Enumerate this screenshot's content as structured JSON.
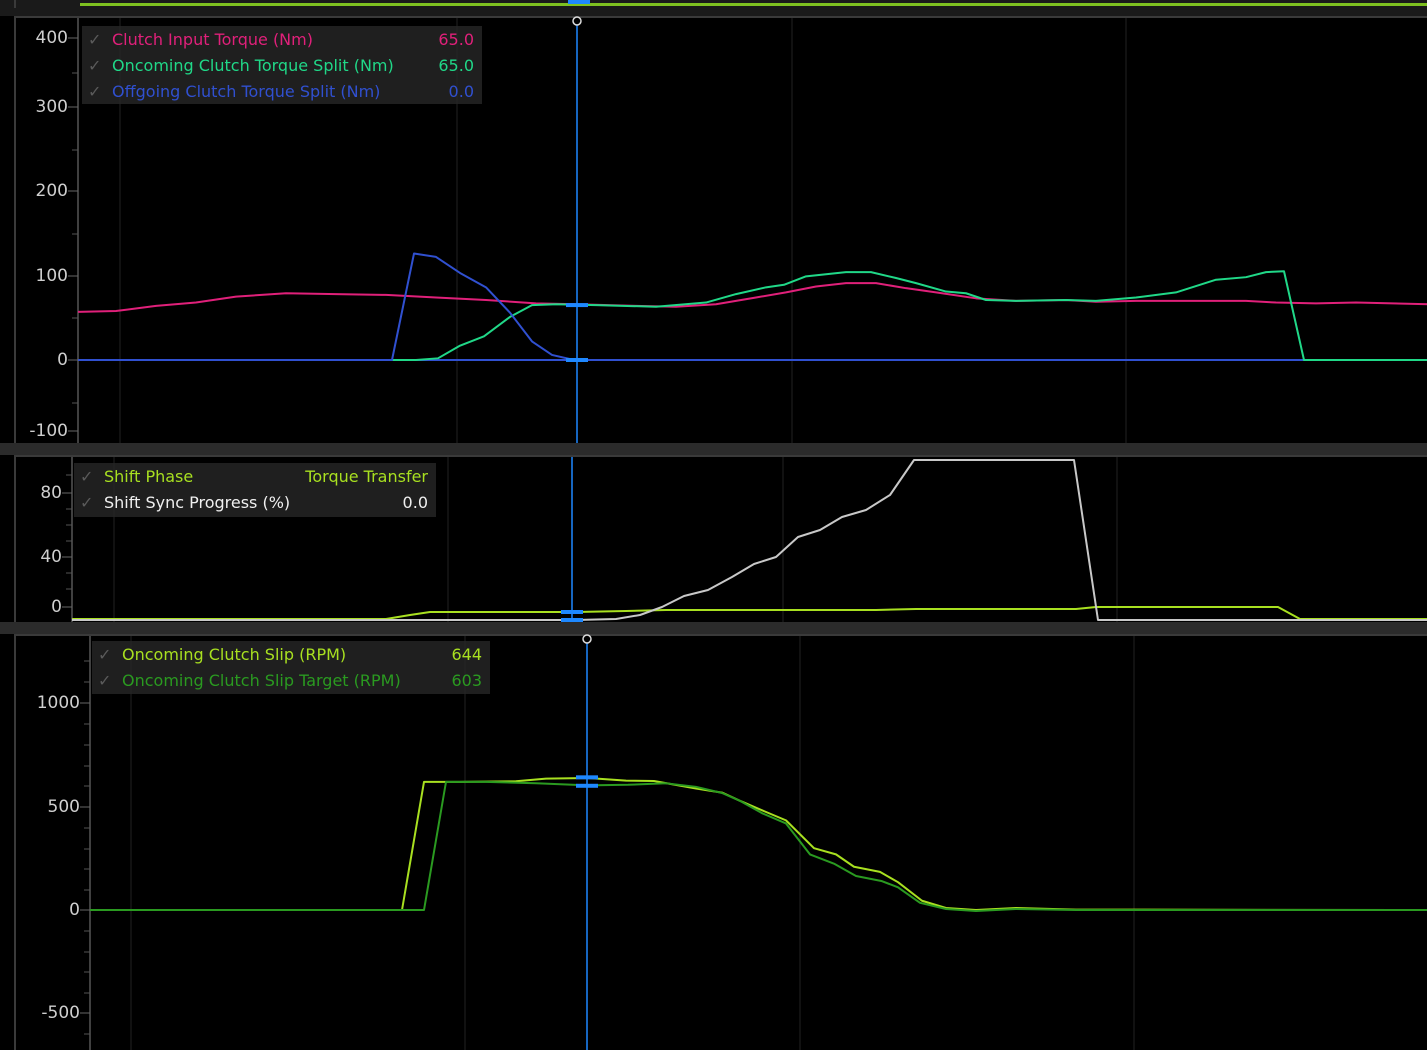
{
  "colors": {
    "magenta": "#e0207a",
    "green": "#20d888",
    "blue": "#3050d0",
    "cursor": "#1e88ff",
    "lime": "#a8e020",
    "darkgreen": "#2a9a20",
    "white": "#f0f0f0",
    "gray": "#c8c8c8"
  },
  "panels": [
    {
      "id": "torque",
      "y_ticks": [
        "400",
        "300",
        "200",
        "100",
        "0",
        "-100"
      ],
      "legend": [
        {
          "name": "Clutch Input Torque (Nm)",
          "value": "65.0",
          "color": "#e0207a"
        },
        {
          "name": "Oncoming Clutch Torque Split (Nm)",
          "value": "65.0",
          "color": "#20d888"
        },
        {
          "name": "Offgoing Clutch Torque Split (Nm)",
          "value": "0.0",
          "color": "#3050d0"
        }
      ]
    },
    {
      "id": "phase",
      "y_ticks": [
        "80",
        "40",
        "0"
      ],
      "legend": [
        {
          "name": "Shift Phase",
          "value": "Torque Transfer",
          "color": "#a8e020"
        },
        {
          "name": "Shift Sync Progress (%)",
          "value": "0.0",
          "color": "#f0f0f0"
        }
      ]
    },
    {
      "id": "slip",
      "y_ticks": [
        "1000",
        "500",
        "0",
        "-500"
      ],
      "legend": [
        {
          "name": "Oncoming Clutch Slip (RPM)",
          "value": "644",
          "color": "#a8e020"
        },
        {
          "name": "Oncoming Clutch Slip Target (RPM)",
          "value": "603",
          "color": "#2a9a20"
        }
      ]
    }
  ]
}
